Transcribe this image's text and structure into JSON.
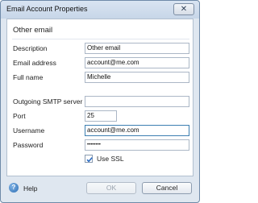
{
  "window": {
    "title": "Email Account Properties",
    "close_glyph": "✕"
  },
  "section_title": "Other email",
  "fields": {
    "description": {
      "label": "Description",
      "value": "Other email"
    },
    "email_address": {
      "label": "Email address",
      "value": "account@me.com"
    },
    "full_name": {
      "label": "Full name",
      "value": "Michelle"
    },
    "smtp_server": {
      "label": "Outgoing SMTP server",
      "value": ""
    },
    "port": {
      "label": "Port",
      "value": "25"
    },
    "username": {
      "label": "Username",
      "value": "account@me.com"
    },
    "password": {
      "label": "Password",
      "value": "••••••••"
    }
  },
  "use_ssl": {
    "label": "Use SSL",
    "checked": true
  },
  "footer": {
    "help_label": "Help",
    "help_icon": "help-circle-icon",
    "ok_label": "OK",
    "ok_disabled": true,
    "cancel_label": "Cancel"
  },
  "colors": {
    "window_bg": "#dfe7f0",
    "border": "#6f8aa8",
    "focus_border": "#3c7fb1",
    "check": "#2b6cc4"
  }
}
